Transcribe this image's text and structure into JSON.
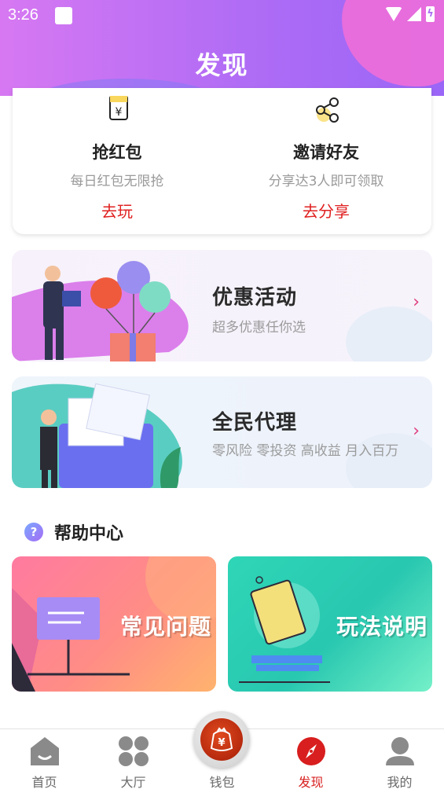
{
  "status_bar": {
    "time": "3:26"
  },
  "header": {
    "title": "发现"
  },
  "features": [
    {
      "title": "抢红包",
      "subtitle": "每日红包无限抢",
      "action": "去玩",
      "icon": "red-packet-icon"
    },
    {
      "title": "邀请好友",
      "subtitle": "分享达3人即可领取",
      "action": "去分享",
      "icon": "share-icon"
    }
  ],
  "banners": [
    {
      "title": "优惠活动",
      "subtitle": "超多优惠任你选",
      "chevron": "›"
    },
    {
      "title": "全民代理",
      "subtitle": "零风险 零投资 高收益 月入百万",
      "chevron": "›"
    }
  ],
  "help": {
    "title": "帮助中心",
    "icon_text": "?",
    "tiles": [
      {
        "label": "常见问题"
      },
      {
        "label": "玩法说明"
      }
    ]
  },
  "nav": {
    "items": [
      {
        "label": "首页",
        "icon": "home-icon"
      },
      {
        "label": "大厅",
        "icon": "grid-icon"
      },
      {
        "label": "钱包",
        "icon": "wallet-icon"
      },
      {
        "label": "发现",
        "icon": "compass-icon",
        "active": true
      },
      {
        "label": "我的",
        "icon": "profile-icon"
      }
    ]
  },
  "colors": {
    "accent": "#d81e1e",
    "header_start": "#d778f2",
    "header_end": "#9a66f7"
  }
}
